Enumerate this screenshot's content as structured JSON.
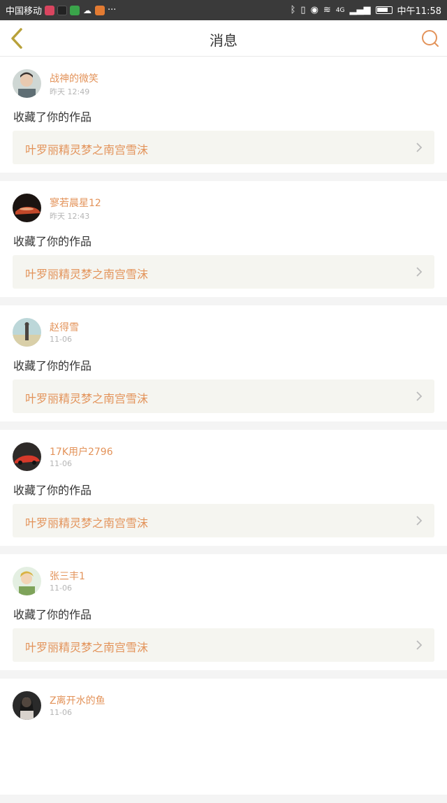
{
  "status_bar": {
    "carrier": "中国移动",
    "more": "···",
    "network": "4G",
    "time": "中午11:58"
  },
  "header": {
    "title": "消息"
  },
  "colors": {
    "accent": "#e3935a",
    "card_bg": "#f5f5f0"
  },
  "messages": [
    {
      "user": "战神的微笑",
      "time": "昨天 12:49",
      "action": "收藏了你的作品",
      "work": "叶罗丽精灵梦之南宫雪沫"
    },
    {
      "user": "寥若晨星12",
      "time": "昨天 12:43",
      "action": "收藏了你的作品",
      "work": "叶罗丽精灵梦之南宫雪沫"
    },
    {
      "user": "赵得雪",
      "time": "11-06",
      "action": "收藏了你的作品",
      "work": "叶罗丽精灵梦之南宫雪沫"
    },
    {
      "user": "17K用户2796",
      "time": "11-06",
      "action": "收藏了你的作品",
      "work": "叶罗丽精灵梦之南宫雪沫"
    },
    {
      "user": "张三丰1",
      "time": "11-06",
      "action": "收藏了你的作品",
      "work": "叶罗丽精灵梦之南宫雪沫"
    },
    {
      "user": "Z离开水的鱼",
      "time": "11-06",
      "action": "",
      "work": ""
    }
  ]
}
